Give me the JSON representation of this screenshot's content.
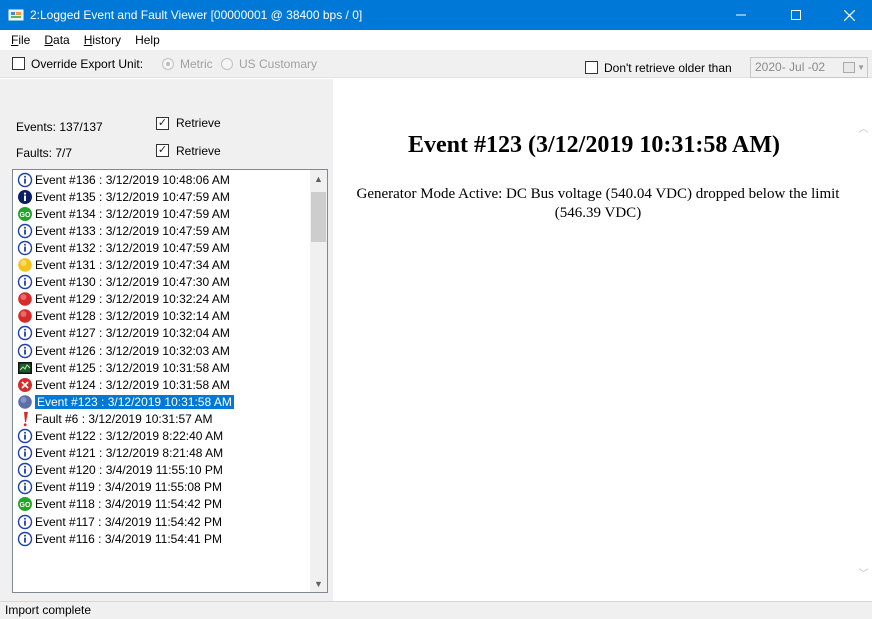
{
  "window": {
    "title": "2:Logged Event and Fault Viewer [00000001 @ 38400 bps / 0]",
    "icon": "app-icon",
    "controls": [
      "minimize",
      "maximize",
      "close"
    ]
  },
  "menu": [
    {
      "label": "File",
      "key": "F"
    },
    {
      "label": "Data",
      "key": "D"
    },
    {
      "label": "History",
      "key": "H"
    },
    {
      "label": "Help",
      "key": ""
    }
  ],
  "toolbar": {
    "override_label": "Override Export Unit:",
    "override_checked": false,
    "metric_label": "Metric",
    "metric_selected": true,
    "us_label": "US Customary",
    "us_selected": false,
    "dont_retrieve_label": "Don't retrieve older than",
    "dont_retrieve_checked": false,
    "date_value": "2020- Jul -02"
  },
  "counts": {
    "events_label": "Events: 137/137",
    "events_retrieve_label": "Retrieve",
    "events_retrieve_checked": true,
    "faults_label": "Faults: 7/7",
    "faults_retrieve_label": "Retrieve",
    "faults_retrieve_checked": true
  },
  "list": [
    {
      "text": "Event #136 : 3/12/2019 10:48:06 AM",
      "icon": "info-icon",
      "selected": false
    },
    {
      "text": "Event #135 : 3/12/2019 10:47:59 AM",
      "icon": "info-dark-icon",
      "selected": false
    },
    {
      "text": "Event #134 : 3/12/2019 10:47:59 AM",
      "icon": "go-icon",
      "selected": false
    },
    {
      "text": "Event #133 : 3/12/2019 10:47:59 AM",
      "icon": "info-icon",
      "selected": false
    },
    {
      "text": "Event #132 : 3/12/2019 10:47:59 AM",
      "icon": "info-icon",
      "selected": false
    },
    {
      "text": "Event #131 : 3/12/2019 10:47:34 AM",
      "icon": "yellow-circle-icon",
      "selected": false
    },
    {
      "text": "Event #130 : 3/12/2019 10:47:30 AM",
      "icon": "info-icon",
      "selected": false
    },
    {
      "text": "Event #129 : 3/12/2019 10:32:24 AM",
      "icon": "red-circle-icon",
      "selected": false
    },
    {
      "text": "Event #128 : 3/12/2019 10:32:14 AM",
      "icon": "red-circle-icon",
      "selected": false
    },
    {
      "text": "Event #127 : 3/12/2019 10:32:04 AM",
      "icon": "info-icon",
      "selected": false
    },
    {
      "text": "Event #126 : 3/12/2019 10:32:03 AM",
      "icon": "info-icon",
      "selected": false
    },
    {
      "text": "Event #125 : 3/12/2019 10:31:58 AM",
      "icon": "monitor-icon",
      "selected": false
    },
    {
      "text": "Event #124 : 3/12/2019 10:31:58 AM",
      "icon": "error-x-icon",
      "selected": false
    },
    {
      "text": "Event #123 : 3/12/2019 10:31:58 AM",
      "icon": "blue-circle-icon",
      "selected": true
    },
    {
      "text": "Fault #6 : 3/12/2019 10:31:57 AM",
      "icon": "exclamation-icon",
      "selected": false
    },
    {
      "text": "Event #122 : 3/12/2019 8:22:40 AM",
      "icon": "info-icon",
      "selected": false
    },
    {
      "text": "Event #121 : 3/12/2019 8:21:48 AM",
      "icon": "info-icon",
      "selected": false
    },
    {
      "text": "Event #120 : 3/4/2019 11:55:10 PM",
      "icon": "info-icon",
      "selected": false
    },
    {
      "text": "Event #119 : 3/4/2019 11:55:08 PM",
      "icon": "info-icon",
      "selected": false
    },
    {
      "text": "Event #118 : 3/4/2019 11:54:42 PM",
      "icon": "go-icon",
      "selected": false
    },
    {
      "text": "Event #117 : 3/4/2019 11:54:42 PM",
      "icon": "info-icon",
      "selected": false
    },
    {
      "text": "Event #116 : 3/4/2019 11:54:41 PM",
      "icon": "info-icon",
      "selected": false
    }
  ],
  "detail": {
    "title": "Event #123 (3/12/2019 10:31:58 AM)",
    "description": "Generator Mode Active: DC Bus voltage (540.04 VDC) dropped below the limit (546.39 VDC)"
  },
  "status": {
    "text": "Import complete"
  },
  "colors": {
    "titlebar": "#0078d7",
    "selection": "#0078d7",
    "info_blue": "#1e3fae",
    "go_green": "#22a52a",
    "alarm_red": "#d62b2b",
    "warn_yellow": "#f3c21b"
  }
}
